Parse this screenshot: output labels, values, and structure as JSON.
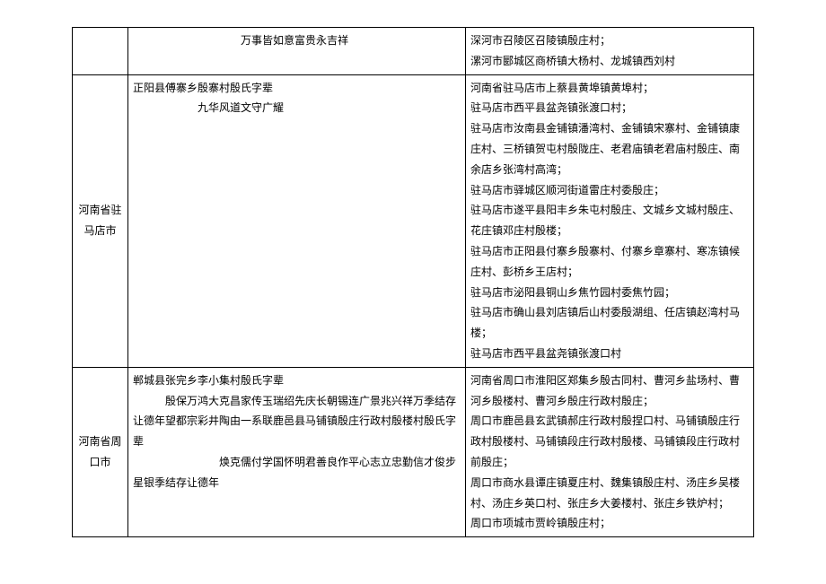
{
  "rows": [
    {
      "region": "",
      "middle_lines": [
        "万事皆如意富贵永吉祥"
      ],
      "middle_classes": [
        "indent1"
      ],
      "right_lines": [
        "深河市召陵区召陵镇殷庄村；",
        "漯河市郾城区商桥镇大杨村、龙城镇西刘村"
      ]
    },
    {
      "region": "河南省驻马店市",
      "middle_lines": [
        "正阳县傅寨乡殷寨村殷氏字辈",
        "九华风道文守广耀"
      ],
      "middle_classes": [
        "",
        "indent2"
      ],
      "right_lines": [
        "河南省驻马店市上蔡县黄埠镇黄埠村；",
        "驻马店市西平县盆尧镇张渡口村；",
        "驻马店市汝南县金铺镇潘湾村、金铺镇宋寨村、金铺镇康庄村、三桥镇贺屯村殷陇庄、老君庙镇老君庙村殷庄、南余店乡张湾村高湾；",
        "驻马店市驿城区顺河街道雷庄村委殷庄；",
        "驻马店市遂平县阳丰乡朱屯村殷庄、文城乡文城村殷庄、花庄镇邓庄村殷楼；",
        "驻马店市正阳县付寨乡殷寨村、付寨乡章寨村、寒冻镇候庄村、彭桥乡王店村；",
        "驻马店市泌阳县铜山乡焦竹园村委焦竹园；",
        "驻马店市确山县刘店镇后山村委殷湖组、任店镇赵湾村马楼；",
        "驻马店市西平县盆尧镇张渡口村"
      ]
    },
    {
      "region": "河南省周口市",
      "middle_lines": [
        "郸城县张完乡李小集村殷氏字辈",
        "殷保万鸿大克昌家传玉瑞绍先庆长朝锡连广景兆兴祥万季结存让德年望都宗彩井陶由一系联鹿邑县马铺镇殷庄行政村殷楼村殷氏字辈",
        "焕克儒付学国怀明君善良作平心志立忠勤信才俊步星银季结存让德年"
      ],
      "middle_classes": [
        "",
        "indent3",
        "indent4"
      ],
      "right_lines": [
        "河南省周口市淮阳区郑集乡殷古同村、曹河乡盐场村、曹河乡殷楼村、曹河乡殷庄行政村殷庄；",
        "周口市鹿邑县玄武镇郝庄行政村殷捏口村、马铺镇殷庄行政村殷楼村、马铺镇段庄行政村殷楼、马铺镇段庄行政村前殷庄；",
        "周口市商水县谭庄镇夏庄村、魏集镇殷庄村、汤庄乡吴楼村、汤庄乡英口村、张庄乡大姜楼村、张庄乡铁炉村；",
        "周口市项城市贾岭镇殷庄村；"
      ]
    }
  ]
}
